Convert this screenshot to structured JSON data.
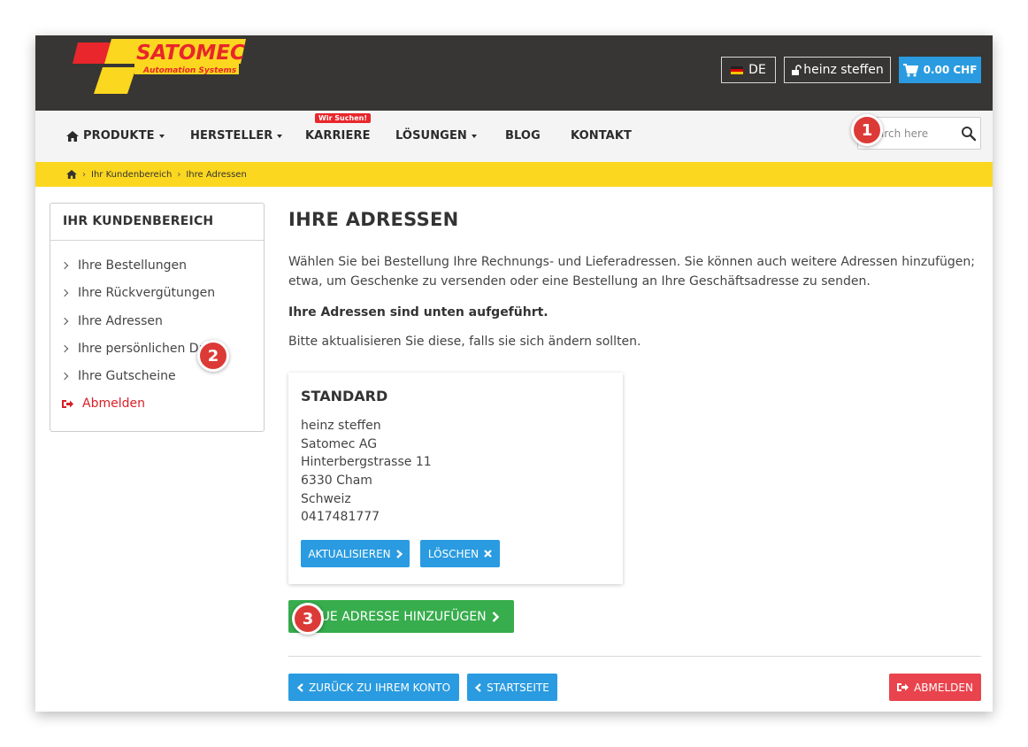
{
  "header": {
    "logo": {
      "text": "SATOMEC",
      "subtitle": "Automation Systems",
      "colors": {
        "yellow": "#fcd71f",
        "red": "#e8262b"
      }
    },
    "language_label": "DE",
    "user_label": "heinz steffen",
    "cart_label": "0.00 CHF"
  },
  "nav": {
    "items": [
      {
        "label": "PRODUKTE",
        "icon": "home-icon"
      },
      {
        "label": "HERSTELLER"
      },
      {
        "label": "KARRIERE",
        "badge": "Wir Suchen!"
      },
      {
        "label": "LÖSUNGEN"
      },
      {
        "label": "BLOG"
      },
      {
        "label": "KONTAKT"
      }
    ],
    "search_placeholder": "Search here"
  },
  "breadcrumb": [
    "Ihr Kundenbereich",
    "Ihre Adressen"
  ],
  "sidebar": {
    "title": "IHR KUNDENBEREICH",
    "items": [
      {
        "label": "Ihre Bestellungen"
      },
      {
        "label": "Ihre Rückvergütungen"
      },
      {
        "label": "Ihre Adressen"
      },
      {
        "label": "Ihre persönlichen Daten"
      },
      {
        "label": "Ihre Gutscheine"
      }
    ],
    "logout_label": "Abmelden"
  },
  "main": {
    "title": "IHRE ADRESSEN",
    "intro": "Wählen Sie bei Bestellung Ihre Rechnungs- und Lieferadressen. Sie können auch weitere Adressen hinzufügen; etwa, um Geschenke zu versenden oder eine Bestellung an Ihre Geschäftsadresse zu senden.",
    "listed_note": "Ihre Adressen sind unten aufgeführt.",
    "update_note": "Bitte aktualisieren Sie diese, falls sie sich ändern sollten.",
    "address_card": {
      "title": "STANDARD",
      "lines": [
        "heinz steffen",
        "Satomec AG",
        "Hinterbergstrasse 11",
        "6330 Cham",
        "Schweiz",
        "0417481777"
      ],
      "update_label": "AKTUALISIEREN",
      "delete_label": "LÖSCHEN"
    },
    "new_address_label": "NEUE ADRESSE HINZUFÜGEN",
    "back_label": "ZURÜCK ZU IHREM KONTO",
    "home_label": "STARTSEITE",
    "logout_label": "ABMELDEN"
  },
  "markers": [
    "1",
    "2",
    "3"
  ],
  "colors": {
    "accent_blue": "#2a9be0",
    "accent_green": "#37ad4d",
    "accent_red": "#e9444d",
    "header_dark": "#373634",
    "breadcrumb_yellow": "#fcd71f"
  }
}
